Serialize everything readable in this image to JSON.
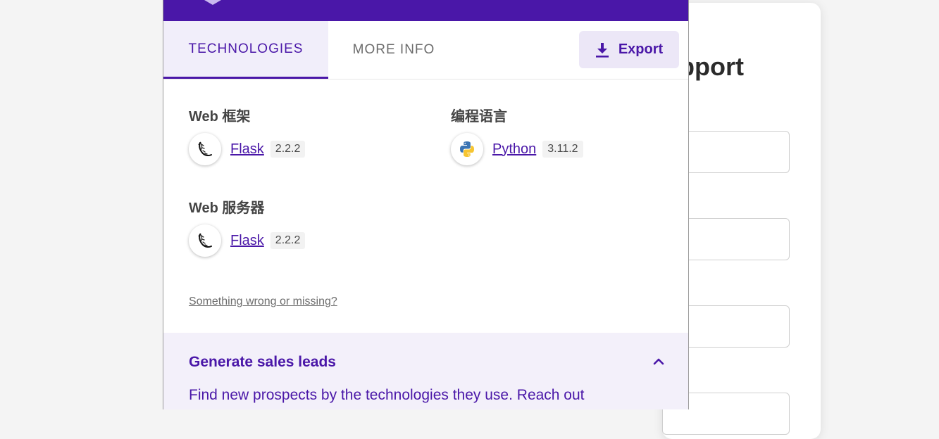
{
  "background_page": {
    "heading": "upport"
  },
  "tabs": [
    {
      "label": "TECHNOLOGIES",
      "active": true
    },
    {
      "label": "MORE INFO",
      "active": false
    }
  ],
  "export_button": {
    "label": "Export",
    "icon": "download-icon"
  },
  "categories": [
    {
      "title": "Web 框架",
      "technologies": [
        {
          "name": "Flask",
          "version": "2.2.2",
          "icon": "flask-icon"
        }
      ]
    },
    {
      "title": "编程语言",
      "technologies": [
        {
          "name": "Python",
          "version": "3.11.2",
          "icon": "python-icon"
        }
      ]
    },
    {
      "title": "Web 服务器",
      "technologies": [
        {
          "name": "Flask",
          "version": "2.2.2",
          "icon": "flask-icon"
        }
      ]
    }
  ],
  "report_link": "Something wrong or missing?",
  "leads": {
    "title": "Generate sales leads",
    "description": "Find new prospects by the technologies they use. Reach out",
    "expanded": true
  },
  "colors": {
    "brand": "#4a17a8",
    "tab_active_bg": "#f1eefa",
    "export_bg": "#ece7f7",
    "leads_bg": "#f3f0fa",
    "page_bg": "#f4f4f4"
  }
}
